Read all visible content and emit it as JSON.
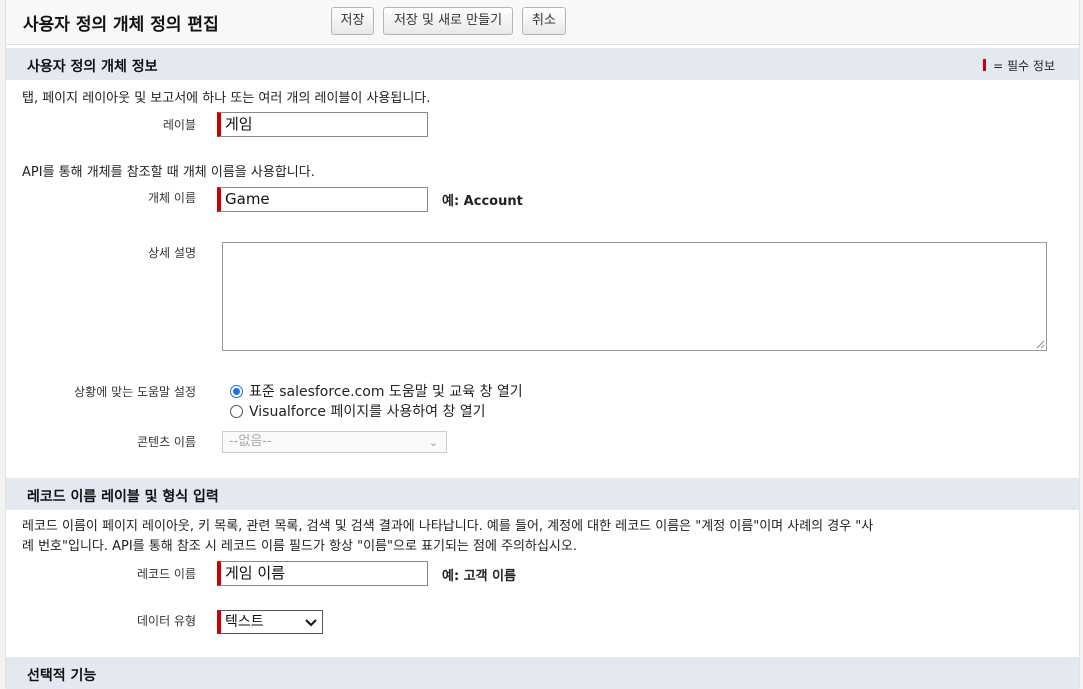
{
  "header": {
    "title": "사용자 정의 개체 정의 편집",
    "buttons": {
      "save": "저장",
      "save_new": "저장 및 새로 만들기",
      "cancel": "취소"
    }
  },
  "section_info": {
    "title": "사용자 정의 개체 정보",
    "required_legend": "= 필수 정보",
    "required_color": "#cc0000",
    "label_desc": "탭, 페이지 레이아웃 및 보고서에 하나 또는 여러 개의 레이블이 사용됩니다.",
    "label_field": {
      "label": "레이블",
      "value": "게임"
    },
    "api_desc": "API를 통해 개체를 참조할 때 개체 이름을 사용합니다.",
    "object_name": {
      "label": "개체 이름",
      "value": "Game",
      "example": "예:  Account"
    },
    "description": {
      "label": "상세 설명",
      "value": ""
    },
    "help": {
      "label": "상황에 맞는 도움말 설정",
      "options": [
        "표준 salesforce.com 도움말 및 교육 창 열기",
        "Visualforce 페이지를 사용하여 창 열기"
      ],
      "selected_index": 0
    },
    "content_name": {
      "label": "콘텐츠 이름",
      "value": "--없음--"
    }
  },
  "section_record": {
    "title": "레코드 이름 레이블 및 형식 입력",
    "desc_line1": "레코드 이름이 페이지 레이아웃, 키 목록, 관련 목록, 검색 및 검색 결과에 나타납니다. 예를 들어, 계정에 대한 레코드 이름은 \"계정 이름\"이며 사례의 경우 \"사",
    "desc_line2": "례 번호\"입니다. API를 통해 참조 시 레코드 이름 필드가 항상 \"이름\"으로 표기되는 점에 주의하십시오.",
    "record_name": {
      "label": "레코드 이름",
      "value": "게임 이름",
      "example": "예:  고객 이름"
    },
    "data_type": {
      "label": "데이터 유형",
      "value": "텍스트"
    }
  },
  "section_optional": {
    "title": "선택적 기능"
  }
}
